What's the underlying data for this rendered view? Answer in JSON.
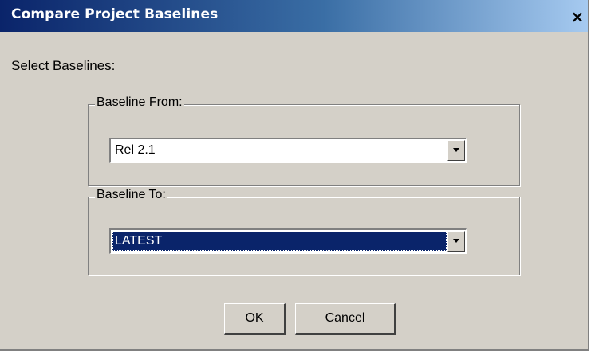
{
  "window": {
    "title": "Compare Project Baselines",
    "close_label": "×"
  },
  "main": {
    "instruction": "Select Baselines:"
  },
  "baseline_from": {
    "legend": "Baseline From:",
    "selected_value": "Rel 2.1"
  },
  "baseline_to": {
    "legend": "Baseline To:",
    "selected_value": "LATEST"
  },
  "buttons": {
    "ok_label": "OK",
    "cancel_label": "Cancel"
  },
  "colors": {
    "dialog_bg": "#d4d0c8",
    "title_gradient_start": "#0a246a",
    "selection_bg": "#0a246a"
  },
  "icons": {
    "combo_dropdown": "chevron-down-icon"
  }
}
